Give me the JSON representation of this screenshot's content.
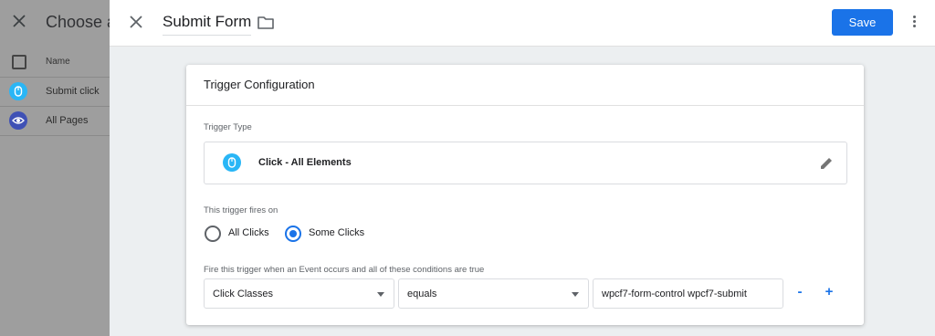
{
  "background_panel": {
    "title": "Choose a",
    "column_header": "Name",
    "rows": [
      {
        "label": "Submit click",
        "icon": "mouse-click-icon"
      },
      {
        "label": "All Pages",
        "icon": "eye-icon"
      }
    ]
  },
  "topbar": {
    "title": "Submit Form",
    "save_label": "Save"
  },
  "trigger_config": {
    "heading": "Trigger Configuration",
    "type_label": "Trigger Type",
    "type_name": "Click - All Elements",
    "fires_on_label": "This trigger fires on",
    "options": [
      "All Clicks",
      "Some Clicks"
    ],
    "selected_option": "Some Clicks",
    "conditions_label": "Fire this trigger when an Event occurs and all of these conditions are true",
    "condition": {
      "variable": "Click Classes",
      "operator": "equals",
      "value": "wpcf7-form-control wpcf7-submit"
    },
    "remove_label": "-",
    "add_label": "+"
  },
  "colors": {
    "accent": "#1a73e8",
    "click_icon": "#29b6f6",
    "overlay": "#9e9e9e"
  }
}
